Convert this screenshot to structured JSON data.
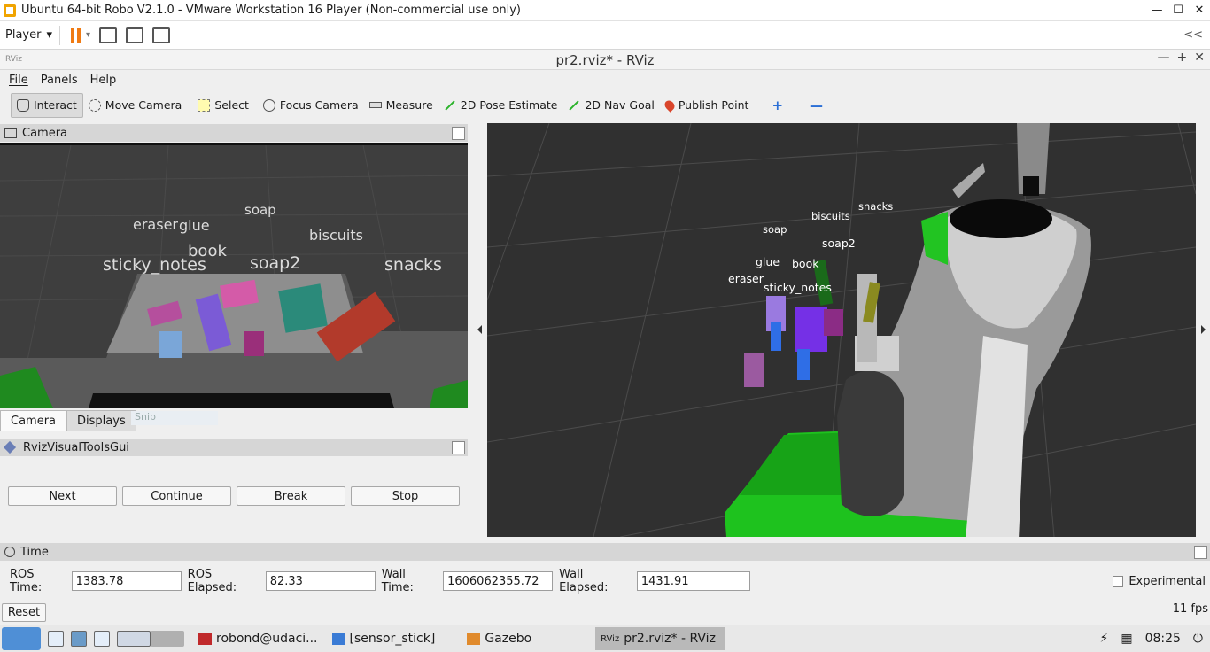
{
  "vm": {
    "title": "Ubuntu 64-bit Robo V2.1.0 - VMware Workstation 16 Player (Non-commercial use only)",
    "window_controls": [
      "—",
      "☐",
      "✕"
    ],
    "player_menu": "Player",
    "collapse": "<<"
  },
  "rviz": {
    "title": "pr2.rviz* - RViz",
    "logo": "RViz",
    "window_controls": [
      "—",
      "+",
      "✕"
    ]
  },
  "menu": [
    "File",
    "Panels",
    "Help"
  ],
  "tools": {
    "interact": "Interact",
    "move_camera": "Move Camera",
    "select": "Select",
    "focus_camera": "Focus Camera",
    "measure": "Measure",
    "pose_estimate": "2D Pose Estimate",
    "nav_goal": "2D Nav Goal",
    "publish_point": "Publish Point",
    "add": "+",
    "remove": "—"
  },
  "camera_panel": {
    "title": "Camera",
    "labels": [
      "eraser",
      "glue",
      "soap",
      "biscuits",
      "book",
      "sticky_notes",
      "soap2",
      "snacks"
    ],
    "snip": "Snip"
  },
  "tabs": [
    "Camera",
    "Displays"
  ],
  "rviz_tools": {
    "title": "RvizVisualToolsGui",
    "buttons": [
      "Next",
      "Continue",
      "Break",
      "Stop"
    ]
  },
  "scene_labels": [
    "snacks",
    "biscuits",
    "soap",
    "soap2",
    "glue",
    "book",
    "eraser",
    "sticky_notes"
  ],
  "time": {
    "title": "Time",
    "ros_time_label": "ROS Time:",
    "ros_time": "1383.78",
    "ros_elapsed_label": "ROS Elapsed:",
    "ros_elapsed": "82.33",
    "wall_time_label": "Wall Time:",
    "wall_time": "1606062355.72",
    "wall_elapsed_label": "Wall Elapsed:",
    "wall_elapsed": "1431.91",
    "experimental": "Experimental",
    "reset": "Reset",
    "fps": "11 fps"
  },
  "taskbar": {
    "tasks": [
      "robond@udaci...",
      "[sensor_stick]",
      "Gazebo",
      "pr2.rviz* - RViz"
    ],
    "rviz_prefix": "RViz",
    "clock": "08:25"
  },
  "colors": {
    "green_object": "#22cc22",
    "purple_cloud": "#7a3df0",
    "grid": "#4a4a4a"
  }
}
